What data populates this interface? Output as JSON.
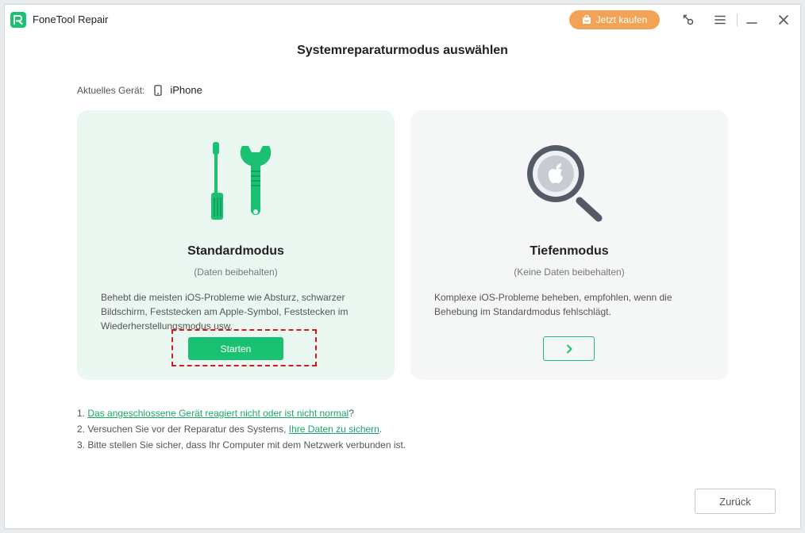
{
  "app": {
    "title": "FoneTool Repair"
  },
  "titlebar": {
    "buy_label": "Jetzt kaufen",
    "icons": [
      "key-icon",
      "menu-icon",
      "minimize-icon",
      "close-icon"
    ]
  },
  "page": {
    "title": "Systemreparaturmodus auswählen",
    "device_label": "Aktuelles Gerät:",
    "device_name": "iPhone"
  },
  "cards": {
    "standard": {
      "title": "Standardmodus",
      "subtitle": "(Daten beibehalten)",
      "description": "Behebt die meisten iOS-Probleme wie Absturz, schwarzer Bildschirm, Feststecken am Apple-Symbol, Feststecken im Wiederherstellungsmodus usw.",
      "button_label": "Starten"
    },
    "deep": {
      "title": "Tiefenmodus",
      "subtitle": "(Keine Daten beibehalten)",
      "description": "Komplexe iOS-Probleme beheben, empfohlen, wenn die Behebung im Standardmodus fehlschlägt.",
      "button_icon": "chevron-right-icon"
    }
  },
  "notes": {
    "n1_prefix": "1. ",
    "n1_link": "Das angeschlossene Gerät reagiert nicht oder ist nicht normal",
    "n1_suffix": "?",
    "n2_prefix": "2. Versuchen Sie vor der Reparatur des Systems, ",
    "n2_link": "Ihre Daten zu sichern",
    "n2_suffix": ".",
    "n3": "3. Bitte stellen Sie sicher, dass Ihr Computer mit dem Netzwerk verbunden ist."
  },
  "footer": {
    "back_label": "Zurück"
  },
  "colors": {
    "accent": "#1bc172",
    "buy": "#f3a355",
    "highlight_border": "#d6181a",
    "card_left_bg": "#eaf8f1",
    "card_right_bg": "#f4f7f6"
  }
}
